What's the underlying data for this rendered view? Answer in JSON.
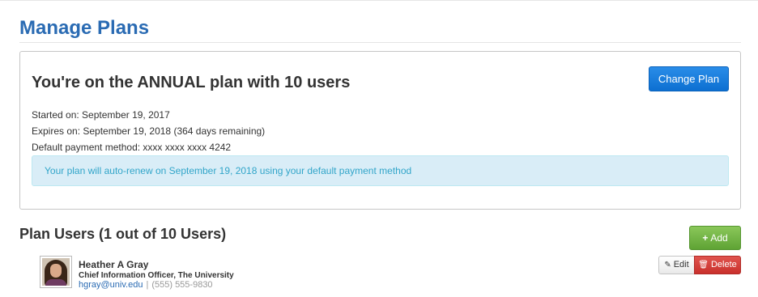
{
  "page": {
    "title": "Manage Plans"
  },
  "plan": {
    "heading": "You're on the ANNUAL plan with 10 users",
    "change_plan_label": "Change Plan",
    "started": "Started on: September 19, 2017",
    "expires": "Expires on: September 19, 2018 (364 days remaining)",
    "payment_method": "Default payment method: xxxx xxxx xxxx 4242",
    "renew_notice": "Your plan will auto-renew on September 19, 2018 using your default payment method"
  },
  "users": {
    "heading": "Plan Users (1 out of 10 Users)",
    "add_label": "Add",
    "add_icon": "plus-icon",
    "list": [
      {
        "name": "Heather A Gray",
        "title": "Chief Information Officer, The University",
        "email": "hgray@univ.edu",
        "separator": "|",
        "phone": "(555) 555-9830",
        "edit_label": "Edit",
        "edit_icon": "pencil-icon",
        "delete_label": "Delete",
        "delete_icon": "trash-icon"
      }
    ]
  },
  "colors": {
    "title_blue": "#2a6bb3",
    "primary_button": "#0d6fd1",
    "success_button": "#5fa334",
    "danger_button": "#c9302c",
    "info_bg": "#d9edf7",
    "info_text": "#31a5c9"
  }
}
